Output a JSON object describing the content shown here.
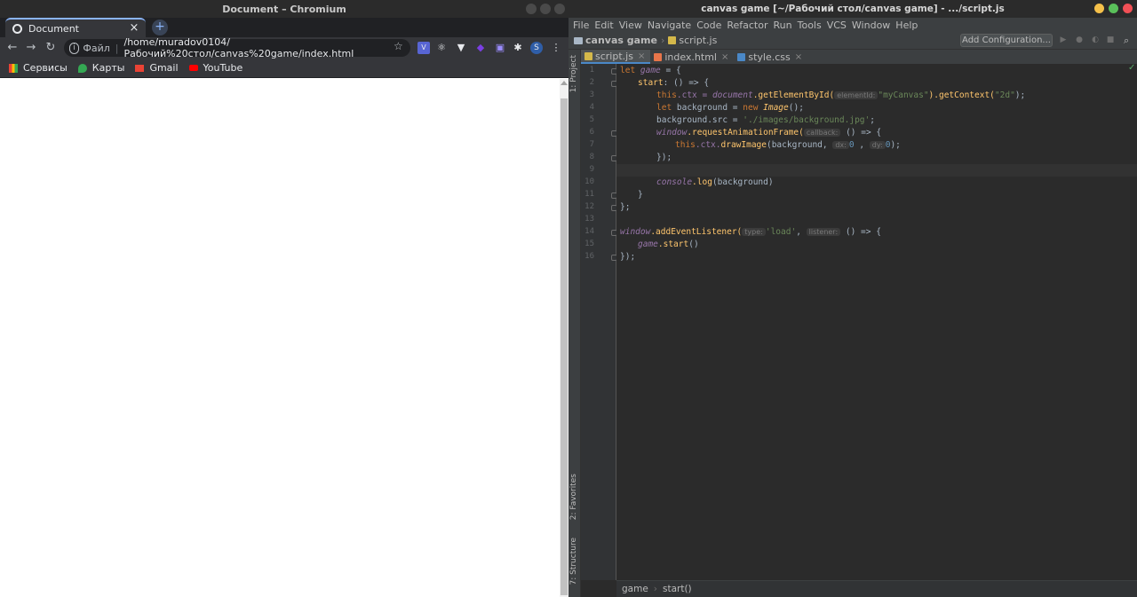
{
  "chromium": {
    "window_title": "Document – Chromium",
    "tab": {
      "title": "Document",
      "close": "×"
    },
    "new_tab": "+",
    "nav": {
      "back": "←",
      "forward": "→",
      "reload": "↻"
    },
    "omnibox": {
      "scheme_label": "Файл",
      "separator": "|",
      "url": "/home/muradov0104/Рабочий%20стол/canvas%20game/index.html"
    },
    "bookmark_star": "☆",
    "menu": "⋮",
    "bookmarks": [
      {
        "label": "Сервисы",
        "icon": "apps-grid-icon"
      },
      {
        "label": "Карты",
        "icon": "maps-pin-icon"
      },
      {
        "label": "Gmail",
        "icon": "gmail-icon"
      },
      {
        "label": "YouTube",
        "icon": "youtube-icon"
      }
    ]
  },
  "ide": {
    "window_title": "canvas game [~/Рабочий стол/canvas game] - .../script.js",
    "menu": [
      "File",
      "Edit",
      "View",
      "Navigate",
      "Code",
      "Refactor",
      "Run",
      "Tools",
      "VCS",
      "Window",
      "Help"
    ],
    "breadcrumbs": {
      "project": "canvas game",
      "file": "script.js",
      "separator": "›"
    },
    "add_configuration": "Add Configuration...",
    "tabs": [
      {
        "label": "script.js",
        "active": true
      },
      {
        "label": "index.html",
        "active": false
      },
      {
        "label": "style.css",
        "active": false
      }
    ],
    "side_tools": {
      "project": "1: Project",
      "favorites": "2: Favorites",
      "structure": "7: Structure"
    },
    "line_numbers": [
      "1",
      "2",
      "3",
      "4",
      "5",
      "6",
      "7",
      "8",
      "9",
      "10",
      "11",
      "12",
      "13",
      "14",
      "15",
      "16"
    ],
    "code": {
      "l1": {
        "kw": "let ",
        "name": "game",
        "rest": " = {"
      },
      "l2": {
        "name": "start",
        "rest": ": () => {"
      },
      "l3": {
        "this": "this",
        "ctx": ".ctx = ",
        "doc": "document",
        "fn": ".getElementById(",
        "hint": "elementId:",
        "str": "\"myCanvas\"",
        "mid": ").getContext(",
        "str2": "\"2d\"",
        "end": ");"
      },
      "l4": {
        "kw": "let ",
        "name": "background = ",
        "kw2": "new ",
        "cls": "Image",
        "end": "();"
      },
      "l5": {
        "name": "background.src = ",
        "str": "'./images/background.jpg'",
        "end": ";"
      },
      "l6": {
        "win": "window",
        "fn": ".requestAnimationFrame(",
        "hint": "callback:",
        "end": " () => {"
      },
      "l7": {
        "this": "this",
        "ctx": ".ctx.",
        "fn": "drawImage",
        "args": "(background, ",
        "hint1": "dx:",
        "n1": "0",
        "comma": " , ",
        "hint2": "dy:",
        "n2": "0",
        "end": ");"
      },
      "l8": {
        "text": "});"
      },
      "l10": {
        "con": "console",
        "fn": ".log",
        "end": "(background)"
      },
      "l11": {
        "text": "}"
      },
      "l12": {
        "text": "};"
      },
      "l14": {
        "win": "window",
        "fn": ".addEventListener(",
        "hint1": "type:",
        "str": "'load'",
        "comma": ", ",
        "hint2": "listener:",
        "end": " () => {"
      },
      "l15": {
        "name": "game",
        "fn": ".start",
        "end": "()"
      },
      "l16": {
        "text": "});"
      }
    },
    "status_breadcrumb": {
      "first": "game",
      "sep": "›",
      "second": "start()"
    }
  }
}
